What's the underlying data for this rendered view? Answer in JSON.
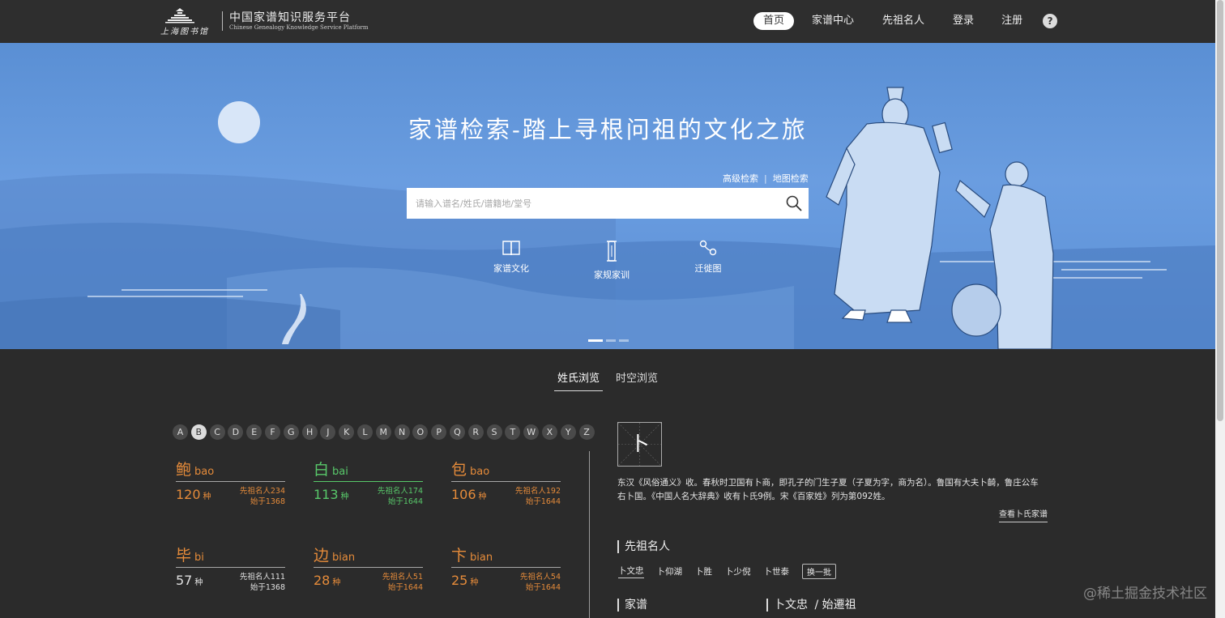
{
  "header": {
    "logo_text_cn": "中国家谱知识服务平台",
    "logo_text_en": "Chinese Genealogy Knowledge Service Platform",
    "logo_library": "上海图书馆",
    "nav": [
      "首页",
      "家谱中心",
      "先祖名人",
      "登录",
      "注册"
    ],
    "help": "?"
  },
  "hero": {
    "title": "家谱检索-踏上寻根问祖的文化之旅",
    "advanced_search": "高级检索",
    "separator": "|",
    "map_search": "地图检索",
    "search_placeholder": "请输入谱名/姓氏/谱籍地/堂号",
    "quick_links": [
      {
        "label": "家谱文化",
        "icon": "book-icon"
      },
      {
        "label": "家规家训",
        "icon": "scroll-icon"
      },
      {
        "label": "迁徙图",
        "icon": "route-icon"
      }
    ],
    "carousel": {
      "count": 3,
      "active": 0
    }
  },
  "browse": {
    "tabs": [
      "姓氏浏览",
      "时空浏览"
    ],
    "letters": [
      "A",
      "B",
      "C",
      "D",
      "E",
      "F",
      "G",
      "H",
      "J",
      "K",
      "L",
      "M",
      "N",
      "O",
      "P",
      "Q",
      "R",
      "S",
      "T",
      "W",
      "X",
      "Y",
      "Z"
    ],
    "active_letter": "B",
    "surnames": [
      {
        "char": "鲍",
        "pinyin": "bao",
        "count": "120",
        "unit": "种",
        "famous": "先祖名人234",
        "since": "始于1368"
      },
      {
        "char": "白",
        "pinyin": "bai",
        "count": "113",
        "unit": "种",
        "famous": "先祖名人174",
        "since": "始于1644"
      },
      {
        "char": "包",
        "pinyin": "bao",
        "count": "106",
        "unit": "种",
        "famous": "先祖名人192",
        "since": "始于1644"
      },
      {
        "char": "毕",
        "pinyin": "bi",
        "count": "57",
        "unit": "种",
        "famous": "先祖名人111",
        "since": "始于1368"
      },
      {
        "char": "边",
        "pinyin": "bian",
        "count": "28",
        "unit": "种",
        "famous": "先祖名人51",
        "since": "始于1644"
      },
      {
        "char": "卞",
        "pinyin": "bian",
        "count": "25",
        "unit": "种",
        "famous": "先祖名人54",
        "since": "始于1644"
      }
    ]
  },
  "detail": {
    "surname": "卜",
    "description": "东汉《风俗通义》收。春秋时卫国有卜商，即孔子的门生子夏（子夏为字，商为名）。鲁国有大夫卜齮，鲁庄公车右卜国。《中国人名大辞典》收有卜氏9例。宋《百家姓》列为第092姓。",
    "see_genealogy": "查看卜氏家谱",
    "ancestors_title": "先祖名人",
    "ancestors": [
      "卜文忠",
      "卜仰湖",
      "卜胜",
      "卜少倪",
      "卜世泰"
    ],
    "swap": "换一批",
    "genealogy_title": "家谱",
    "founder_title": "卜文忠",
    "founder_suffix": "/ 始遷祖"
  },
  "watermark": "@稀土掘金技术社区"
}
